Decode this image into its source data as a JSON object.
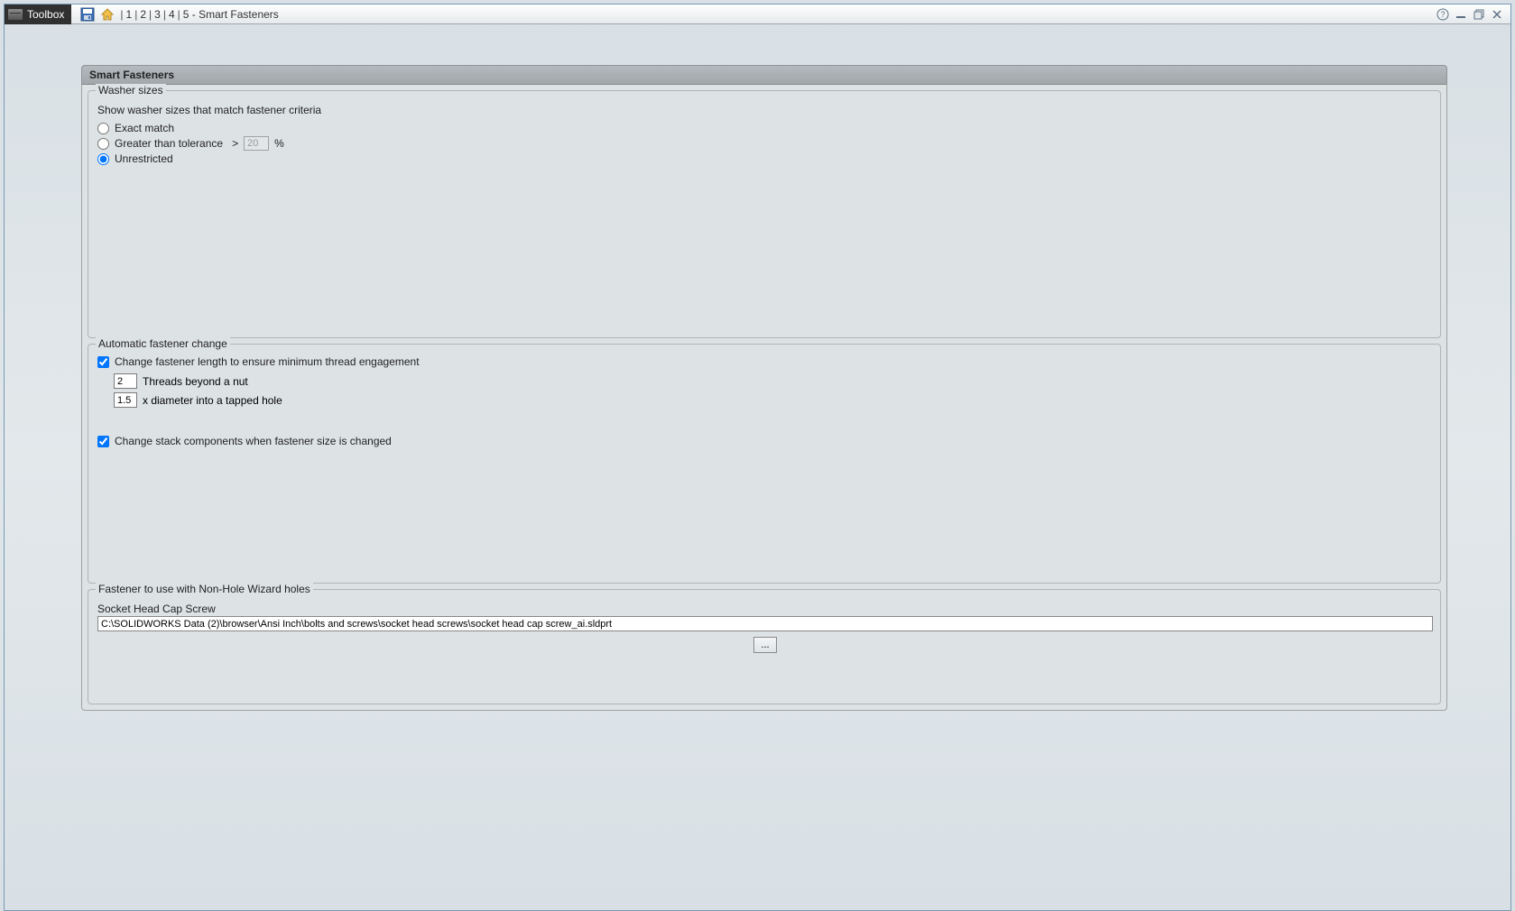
{
  "toolbar": {
    "toolbox_label": "Toolbox",
    "breadcrumb_steps": [
      "1",
      "2",
      "3",
      "4"
    ],
    "breadcrumb_current": "5 - Smart Fasteners"
  },
  "page_title": "Smart Fasteners",
  "washer_sizes": {
    "legend": "Washer sizes",
    "hint": "Show washer sizes that match fastener criteria",
    "opt_exact": "Exact match",
    "opt_greater": "Greater than tolerance",
    "gt_symbol": ">",
    "gt_value": "20",
    "gt_unit": "%",
    "opt_unrestricted": "Unrestricted",
    "selected": "unrestricted"
  },
  "auto_change": {
    "legend": "Automatic fastener change",
    "chk_length_label": "Change fastener length to ensure minimum thread engagement",
    "chk_length_checked": true,
    "threads_value": "2",
    "threads_label": "Threads beyond a nut",
    "diam_value": "1.5",
    "diam_label": "x diameter into a tapped hole",
    "chk_stack_label": "Change stack components when fastener size is changed",
    "chk_stack_checked": true
  },
  "non_hole": {
    "legend": "Fastener to use with Non-Hole Wizard holes",
    "file_label": "Socket Head Cap Screw",
    "file_path": "C:\\SOLIDWORKS Data (2)\\browser\\Ansi Inch\\bolts and screws\\socket head screws\\socket head cap screw_ai.sldprt",
    "browse_label": "..."
  }
}
